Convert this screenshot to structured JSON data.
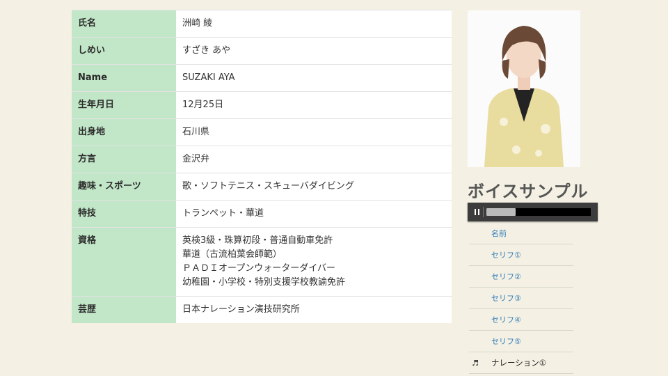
{
  "profile": {
    "rows": [
      {
        "key": "氏名",
        "value": "洲崎 綾"
      },
      {
        "key": "しめい",
        "value": "すざき あや"
      },
      {
        "key": "Name",
        "value": "SUZAKI AYA"
      },
      {
        "key": "生年月日",
        "value": "12月25日"
      },
      {
        "key": "出身地",
        "value": "石川県"
      },
      {
        "key": "方言",
        "value": "金沢弁"
      },
      {
        "key": "趣味・スポーツ",
        "value": "歌・ソフトテニス・スキューバダイビング"
      },
      {
        "key": "特技",
        "value": "トランペット・華道"
      },
      {
        "key": "資格",
        "lines": [
          "英検3級・珠算初段・普通自動車免許",
          "華道（古流柏葉会師範）",
          "ＰＡＤＩオープンウォーターダイバー",
          "幼稚園・小学校・特別支援学校教諭免許"
        ]
      },
      {
        "key": "芸歴",
        "value": "日本ナレーション演技研究所"
      }
    ]
  },
  "voice": {
    "title": "ボイスサンプル",
    "player": {
      "progress": 0.28
    },
    "samples": [
      {
        "label": "名前"
      },
      {
        "label": "セリフ①"
      },
      {
        "label": "セリフ②"
      },
      {
        "label": "セリフ③"
      },
      {
        "label": "セリフ④"
      },
      {
        "label": "セリフ⑤"
      },
      {
        "label": "ナレーション①",
        "icon": "♬"
      }
    ]
  },
  "colors": {
    "key_cell": "#c2e7c8",
    "link": "#2f7ab8",
    "player": "#3c3c3c"
  }
}
